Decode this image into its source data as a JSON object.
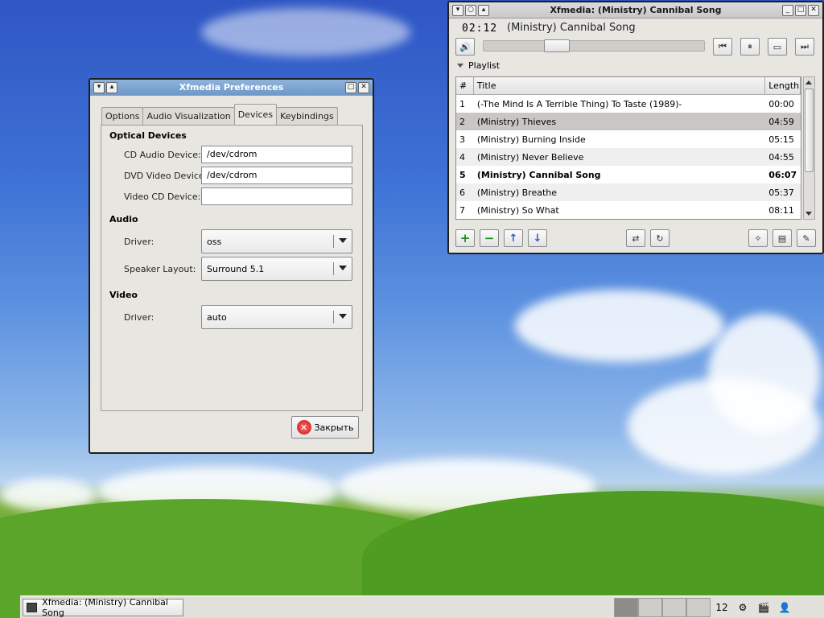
{
  "prefs": {
    "title": "Xfmedia Preferences",
    "tabs": [
      "Options",
      "Audio Visualization",
      "Devices",
      "Keybindings"
    ],
    "active_tab": "Devices",
    "optical": {
      "heading": "Optical Devices",
      "cd_label": "CD Audio Device:",
      "cd_value": "/dev/cdrom",
      "dvd_label": "DVD Video Device:",
      "dvd_value": "/dev/cdrom",
      "vcd_label": "Video CD Device:",
      "vcd_value": ""
    },
    "audio": {
      "heading": "Audio",
      "driver_label": "Driver:",
      "driver_value": "oss",
      "speaker_label": "Speaker Layout:",
      "speaker_value": "Surround 5.1"
    },
    "video": {
      "heading": "Video",
      "driver_label": "Driver:",
      "driver_value": "auto"
    },
    "close_label": "Закрыть"
  },
  "player": {
    "title": "Xfmedia: (Ministry) Cannibal Song",
    "time": "02:12",
    "now_playing": "(Ministry) Cannibal Song",
    "seek_progress": 0.31,
    "playlist_label": "Playlist",
    "columns": {
      "num": "#",
      "title": "Title",
      "length": "Length"
    },
    "rows": [
      {
        "num": "1",
        "title": "(-The Mind Is A Terrible Thing) To Taste (1989)-",
        "length": "00:00"
      },
      {
        "num": "2",
        "title": "(Ministry) Thieves",
        "length": "04:59"
      },
      {
        "num": "3",
        "title": "(Ministry) Burning Inside",
        "length": "05:15"
      },
      {
        "num": "4",
        "title": "(Ministry) Never Believe",
        "length": "04:55"
      },
      {
        "num": "5",
        "title": "(Ministry) Cannibal Song",
        "length": "06:07"
      },
      {
        "num": "6",
        "title": "(Ministry) Breathe",
        "length": "05:37"
      },
      {
        "num": "7",
        "title": "(Ministry) So What",
        "length": "08:11"
      }
    ]
  },
  "taskbar": {
    "task_label": "Xfmedia: (Ministry) Cannibal Song",
    "clock": "12"
  }
}
